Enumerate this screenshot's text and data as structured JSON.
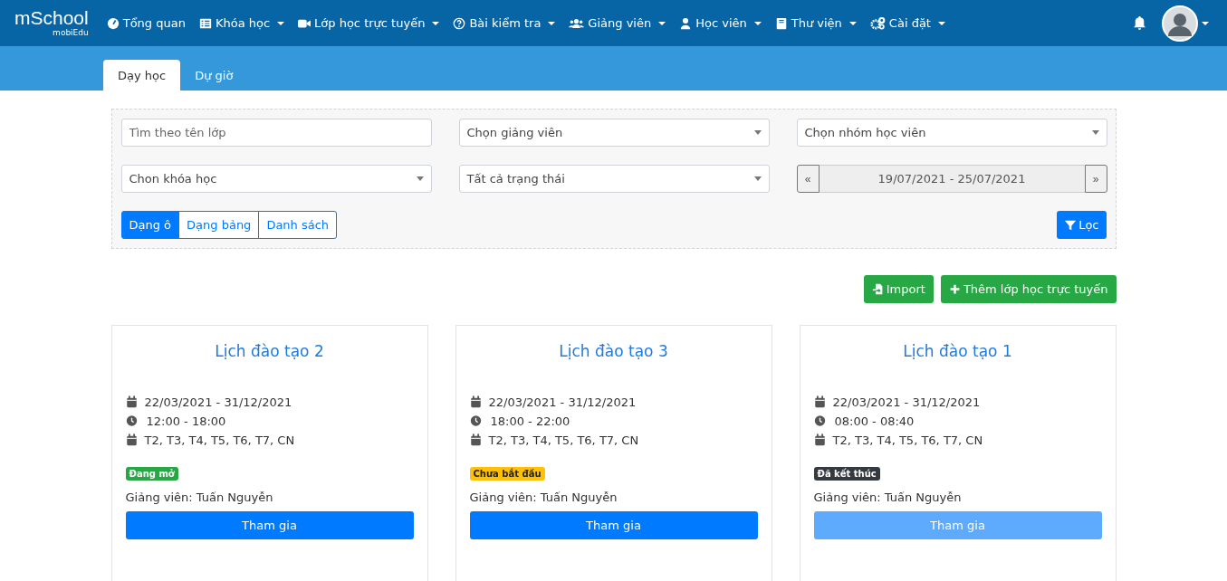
{
  "logo": {
    "title": "mSchool",
    "subtitle": "mobiEdu"
  },
  "nav": [
    {
      "label": "Tổng quan",
      "dropdown": false
    },
    {
      "label": "Khóa học",
      "dropdown": true
    },
    {
      "label": "Lớp học trực tuyến",
      "dropdown": true
    },
    {
      "label": "Bài kiểm tra",
      "dropdown": true
    },
    {
      "label": "Giảng viên",
      "dropdown": true
    },
    {
      "label": "Học viên",
      "dropdown": true
    },
    {
      "label": "Thư viện",
      "dropdown": true
    },
    {
      "label": "Cài đặt",
      "dropdown": true
    }
  ],
  "tabs": [
    {
      "label": "Dạy học",
      "selected": true
    },
    {
      "label": "Dự giờ",
      "selected": false
    }
  ],
  "filters": {
    "search": {
      "placeholder": "Tìm theo tên lớp"
    },
    "selects": [
      "Chọn giảng viên",
      "Chọn nhóm học viên",
      "Chon khóa học",
      "Tất cả trạng thái"
    ],
    "date_range": {
      "prev": "«",
      "value": "19/07/2021 - 25/07/2021",
      "next": "»"
    },
    "views": [
      {
        "label": "Dạng ô",
        "selected": true
      },
      {
        "label": "Dạng bảng",
        "selected": false
      },
      {
        "label": "Danh sách",
        "selected": false
      }
    ],
    "filter_button": "Lọc"
  },
  "actions": [
    "Import",
    "Thêm lớp học trực tuyến"
  ],
  "cards": [
    {
      "title": "Lịch đào tạo 2",
      "dates": "22/03/2021 - 31/12/2021",
      "time": "12:00 - 18:00",
      "days": "T2, T3, T4, T5, T6, T7, CN",
      "status": {
        "label": "Đang mở",
        "kind": "open"
      },
      "teacher": "Giảng viên: Tuấn Nguyễn",
      "button": {
        "label": "Tham gia",
        "disabled": false
      }
    },
    {
      "title": "Lịch đào tạo 3",
      "dates": "22/03/2021 - 31/12/2021",
      "time": "18:00 - 22:00",
      "days": "T2, T3, T4, T5, T6, T7, CN",
      "status": {
        "label": "Chưa bắt đầu",
        "kind": "pending"
      },
      "teacher": "Giảng viên: Tuấn Nguyễn",
      "button": {
        "label": "Tham gia",
        "disabled": false
      }
    },
    {
      "title": "Lịch đào tạo 1",
      "dates": "22/03/2021 - 31/12/2021",
      "time": "08:00 - 08:40",
      "days": "T2, T3, T4, T5, T6, T7, CN",
      "status": {
        "label": "Đã kết thúc",
        "kind": "ended"
      },
      "teacher": "Giảng viên: Tuấn Nguyễn",
      "button": {
        "label": "Tham gia",
        "disabled": true
      }
    }
  ]
}
